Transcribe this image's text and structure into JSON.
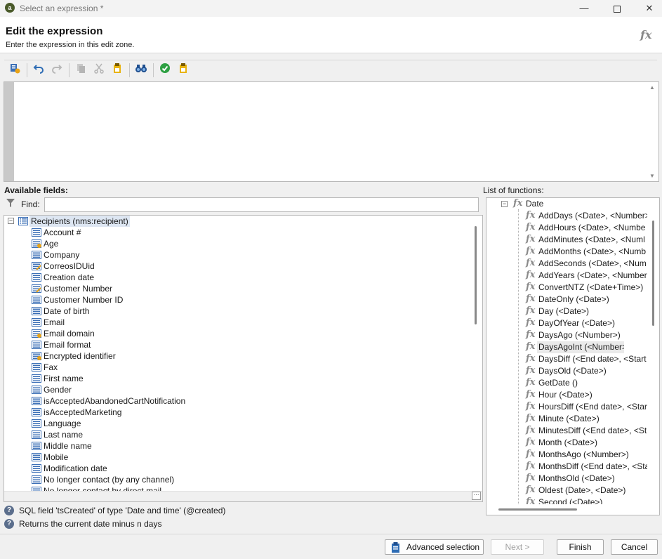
{
  "window": {
    "title": "Select an expression *",
    "app_icon_letter": "a"
  },
  "header": {
    "title": "Edit the expression",
    "subtitle": "Enter the expression in this edit zone.",
    "icon_text": "fx"
  },
  "toolbar": {
    "icons": [
      "field-picker-icon",
      "undo-icon",
      "redo-icon",
      "copy-icon",
      "cut-icon",
      "paste-icon",
      "binoculars-icon",
      "check-icon",
      "clipboard-icon"
    ]
  },
  "editor": {
    "value": ""
  },
  "fields": {
    "label": "Available fields:",
    "find_label": "Find:",
    "find_value": "",
    "root": "Recipients (nms:recipient)",
    "items": [
      {
        "label": "Account #",
        "icon": "field"
      },
      {
        "label": "Age",
        "icon": "calc"
      },
      {
        "label": "Company",
        "icon": "field"
      },
      {
        "label": "CorreosIDUid",
        "icon": "edit"
      },
      {
        "label": "Creation date",
        "icon": "field"
      },
      {
        "label": "Customer Number",
        "icon": "edit"
      },
      {
        "label": "Customer Number ID",
        "icon": "field"
      },
      {
        "label": "Date of birth",
        "icon": "field"
      },
      {
        "label": "Email",
        "icon": "field"
      },
      {
        "label": "Email domain",
        "icon": "calc"
      },
      {
        "label": "Email format",
        "icon": "field"
      },
      {
        "label": "Encrypted identifier",
        "icon": "calc"
      },
      {
        "label": "Fax",
        "icon": "field"
      },
      {
        "label": "First name",
        "icon": "field"
      },
      {
        "label": "Gender",
        "icon": "field"
      },
      {
        "label": "isAcceptedAbandonedCartNotification",
        "icon": "field"
      },
      {
        "label": "isAcceptedMarketing",
        "icon": "field"
      },
      {
        "label": "Language",
        "icon": "field"
      },
      {
        "label": "Last name",
        "icon": "field"
      },
      {
        "label": "Middle name",
        "icon": "field"
      },
      {
        "label": "Mobile",
        "icon": "field"
      },
      {
        "label": "Modification date",
        "icon": "field"
      },
      {
        "label": "No longer contact (by any channel)",
        "icon": "field"
      },
      {
        "label": "No longer contact by direct mail",
        "icon": "field"
      }
    ]
  },
  "functions": {
    "label": "List of functions:",
    "group": "Date",
    "selected_index": 11,
    "items": [
      "AddDays (<Date>, <Number>",
      "AddHours (<Date>, <Numbe",
      "AddMinutes (<Date>, <Numl",
      "AddMonths (<Date>, <Numb",
      "AddSeconds (<Date>, <Num",
      "AddYears (<Date>, <Number",
      "ConvertNTZ (<Date+Time>)",
      "DateOnly (<Date>)",
      "Day (<Date>)",
      "DayOfYear (<Date>)",
      "DaysAgo (<Number>)",
      "DaysAgoInt (<Number>)",
      "DaysDiff (<End date>, <Start",
      "DaysOld (<Date>)",
      "GetDate ()",
      "Hour (<Date>)",
      "HoursDiff (<End date>, <Star",
      "Minute (<Date>)",
      "MinutesDiff (<End date>, <St",
      "Month (<Date>)",
      "MonthsAgo (<Number>)",
      "MonthsDiff (<End date>, <Sta",
      "MonthsOld (<Date>)",
      "Oldest (Date>, <Date>)",
      "Second (<Date>)"
    ]
  },
  "help": {
    "field_info": "SQL field 'tsCreated' of type 'Date and time' (@created)",
    "function_info": "Returns the current date minus n days"
  },
  "footer": {
    "advanced_label": "Advanced selection",
    "next_label": "Next >",
    "finish_label": "Finish",
    "cancel_label": "Cancel"
  }
}
